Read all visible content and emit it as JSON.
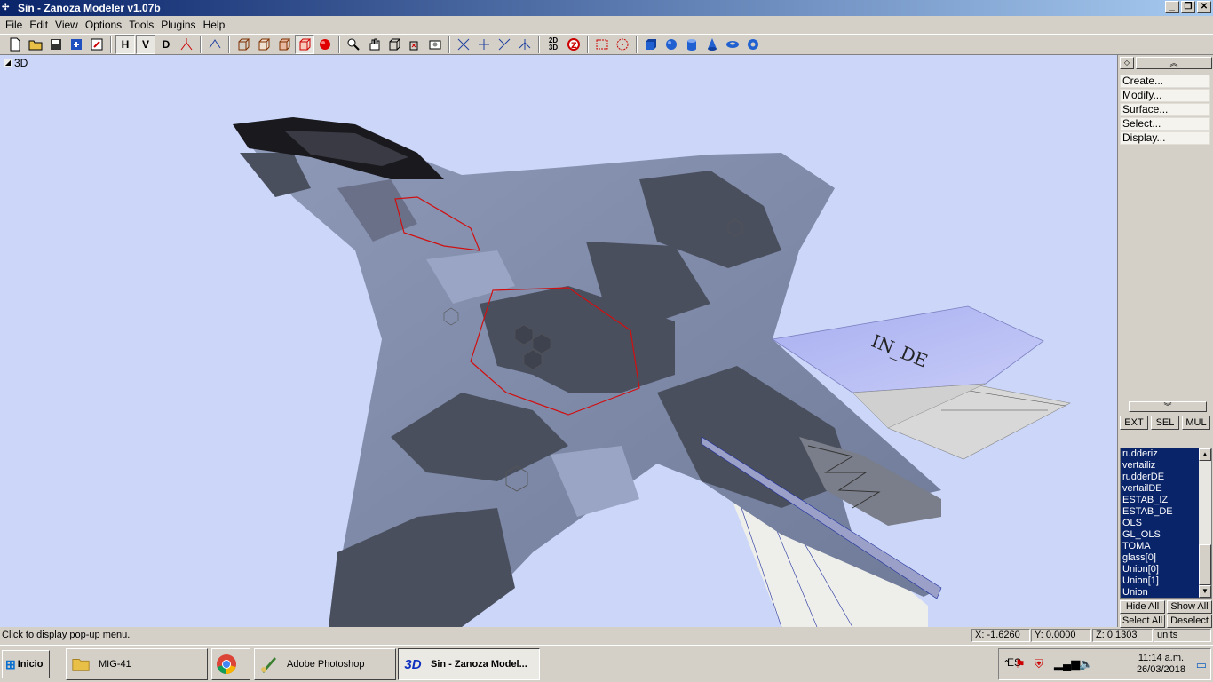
{
  "window": {
    "title": "Sin - Zanoza Modeler v1.07b",
    "app_icon": "zanoza-icon",
    "buttons": [
      "_",
      "❐",
      "✕"
    ]
  },
  "menu": [
    "File",
    "Edit",
    "View",
    "Options",
    "Tools",
    "Plugins",
    "Help"
  ],
  "toolbar": {
    "view_buttons": [
      "H",
      "V",
      "D"
    ]
  },
  "viewport": {
    "label": "3D",
    "tail_text": "IN_DE",
    "background": "#cbd6f9"
  },
  "side_panel": {
    "menu": [
      "Create...",
      "Modify...",
      "Surface...",
      "Select...",
      "Display..."
    ],
    "tabs": [
      "EXT",
      "SEL",
      "MUL"
    ],
    "objects": [
      "rudderiz",
      "vertailiz",
      "rudderDE",
      "vertailDE",
      "ESTAB_IZ",
      "ESTAB_DE",
      "OLS",
      "GL_OLS",
      "TOMA",
      "glass[0]",
      "Union[0]",
      "Union[1]",
      "Union"
    ],
    "row1": [
      "Hide All",
      "Show All"
    ],
    "row2": [
      "Select All",
      "Deselect"
    ]
  },
  "status": {
    "message": "Click to display pop-up menu.",
    "x": "X: -1.6260",
    "y": "Y: 0.0000",
    "z": "Z: 0.1303",
    "units": "units"
  },
  "taskbar": {
    "start": "Inicio",
    "tasks": [
      "MIG-41",
      "Adobe Photoshop",
      "Sin - Zanoza Model..."
    ],
    "lang": "ES",
    "time": "11:14 a.m.",
    "date": "26/03/2018"
  }
}
